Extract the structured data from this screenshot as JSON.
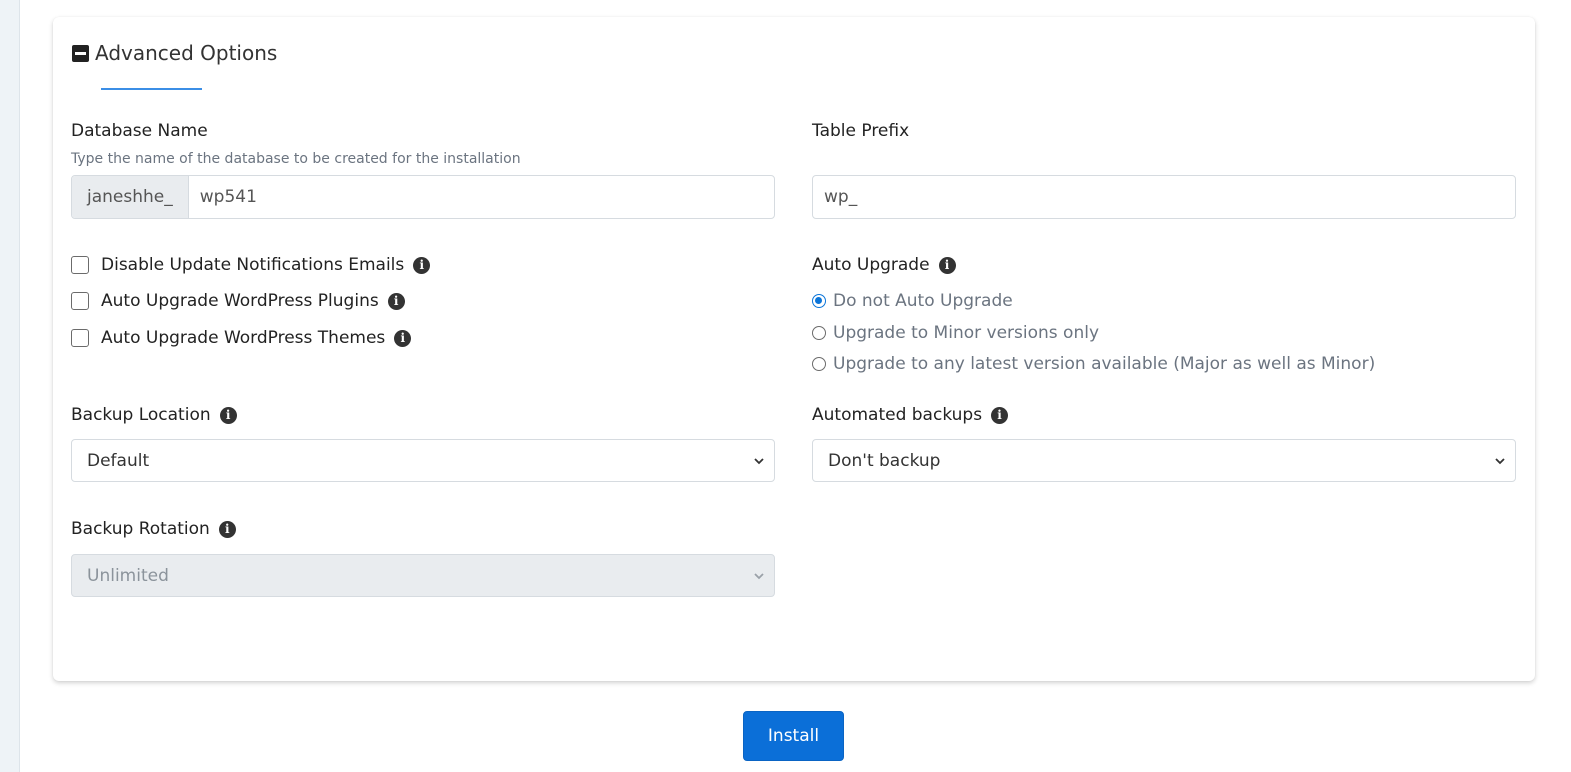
{
  "section": {
    "title": "Advanced Options"
  },
  "database": {
    "label": "Database Name",
    "help": "Type the name of the database to be created for the installation",
    "prefix": "janeshhe_",
    "value": "wp541"
  },
  "table_prefix": {
    "label": "Table Prefix",
    "value": "wp_"
  },
  "checkboxes": [
    {
      "label": "Disable Update Notifications Emails",
      "checked": false
    },
    {
      "label": "Auto Upgrade WordPress Plugins",
      "checked": false
    },
    {
      "label": "Auto Upgrade WordPress Themes",
      "checked": false
    }
  ],
  "auto_upgrade": {
    "label": "Auto Upgrade",
    "options": [
      {
        "label": "Do not Auto Upgrade",
        "checked": true
      },
      {
        "label": "Upgrade to Minor versions only",
        "checked": false
      },
      {
        "label": "Upgrade to any latest version available (Major as well as Minor)",
        "checked": false
      }
    ]
  },
  "backup_location": {
    "label": "Backup Location",
    "selected": "Default"
  },
  "automated_backups": {
    "label": "Automated backups",
    "selected": "Don't backup"
  },
  "backup_rotation": {
    "label": "Backup Rotation",
    "selected": "Unlimited",
    "disabled": true
  },
  "install_button": {
    "label": "Install"
  },
  "colors": {
    "accent": "#0b6fd8",
    "underline": "#3b8ee6"
  }
}
